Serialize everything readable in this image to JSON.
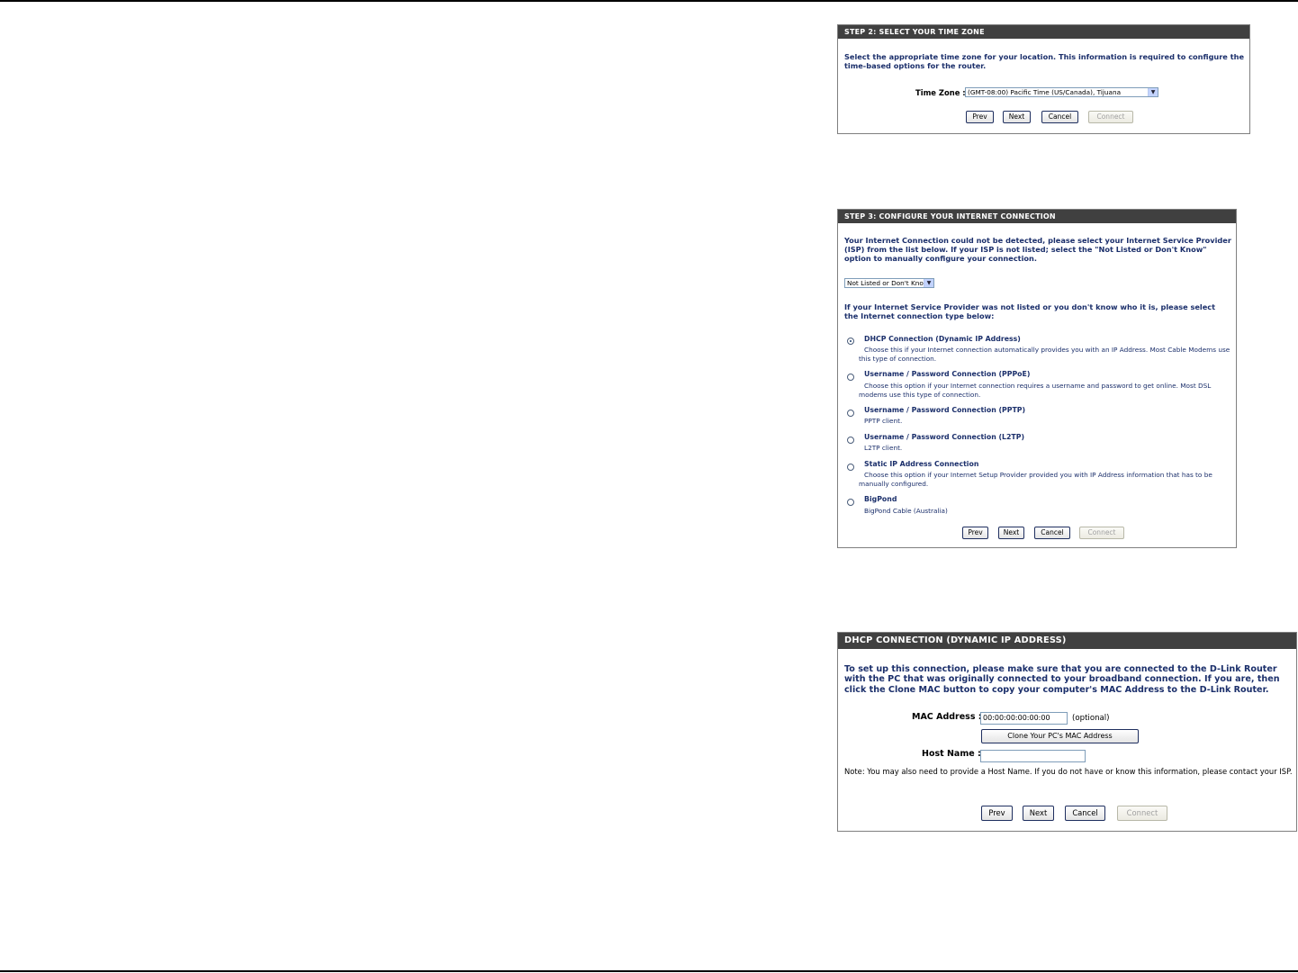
{
  "step2": {
    "title": "STEP 2: SELECT YOUR TIME ZONE",
    "intro": "Select the appropriate time zone for your location. This information is required to configure the time-based options for the router.",
    "timezone_label": "Time Zone :",
    "timezone_value": "(GMT-08:00) Pacific Time (US/Canada), Tijuana",
    "buttons": {
      "prev": "Prev",
      "next": "Next",
      "cancel": "Cancel",
      "connect": "Connect"
    }
  },
  "step3": {
    "title": "STEP 3: CONFIGURE YOUR INTERNET CONNECTION",
    "intro": "Your Internet Connection could not be detected, please select your Internet Service Provider (ISP) from the list below. If your ISP is not listed; select the \"Not Listed or Don't Know\" option to manually configure your connection.",
    "isp_value": "Not Listed or Don't Know",
    "type_prompt": "If your Internet Service Provider was not listed or you don't know who it is, please select the Internet connection type below:",
    "options": [
      {
        "title": "DHCP Connection (Dynamic IP Address)",
        "desc": "Choose this if your Internet connection automatically provides you with an IP Address. Most Cable Modems use this type of connection.",
        "selected": true
      },
      {
        "title": "Username / Password Connection (PPPoE)",
        "desc": "Choose this option if your Internet connection requires a username and password to get online. Most DSL modems use this type of connection.",
        "selected": false
      },
      {
        "title": "Username / Password Connection (PPTP)",
        "desc": "PPTP client.",
        "selected": false
      },
      {
        "title": "Username / Password Connection (L2TP)",
        "desc": "L2TP client.",
        "selected": false
      },
      {
        "title": "Static IP Address Connection",
        "desc": "Choose this option if your Internet Setup Provider provided you with IP Address information that has to be manually configured.",
        "selected": false
      },
      {
        "title": "BigPond",
        "desc": "BigPond Cable (Australia)",
        "selected": false
      }
    ],
    "buttons": {
      "prev": "Prev",
      "next": "Next",
      "cancel": "Cancel",
      "connect": "Connect"
    }
  },
  "dhcp": {
    "title": "DHCP CONNECTION (DYNAMIC IP ADDRESS)",
    "intro": "To set up this connection, please make sure that you are connected to the D-Link Router with the PC that was originally connected to your broadband connection. If you are, then click the Clone MAC button to copy your computer's MAC Address to the D-Link Router.",
    "mac_label": "MAC Address :",
    "mac_value": "00:00:00:00:00:00",
    "mac_optional": "(optional)",
    "clone_button": "Clone Your PC's MAC Address",
    "host_label": "Host Name :",
    "host_value": "",
    "note": "Note: You may also need to provide a Host Name. If you do not have or know this information, please contact your ISP.",
    "buttons": {
      "prev": "Prev",
      "next": "Next",
      "cancel": "Cancel",
      "connect": "Connect"
    }
  }
}
